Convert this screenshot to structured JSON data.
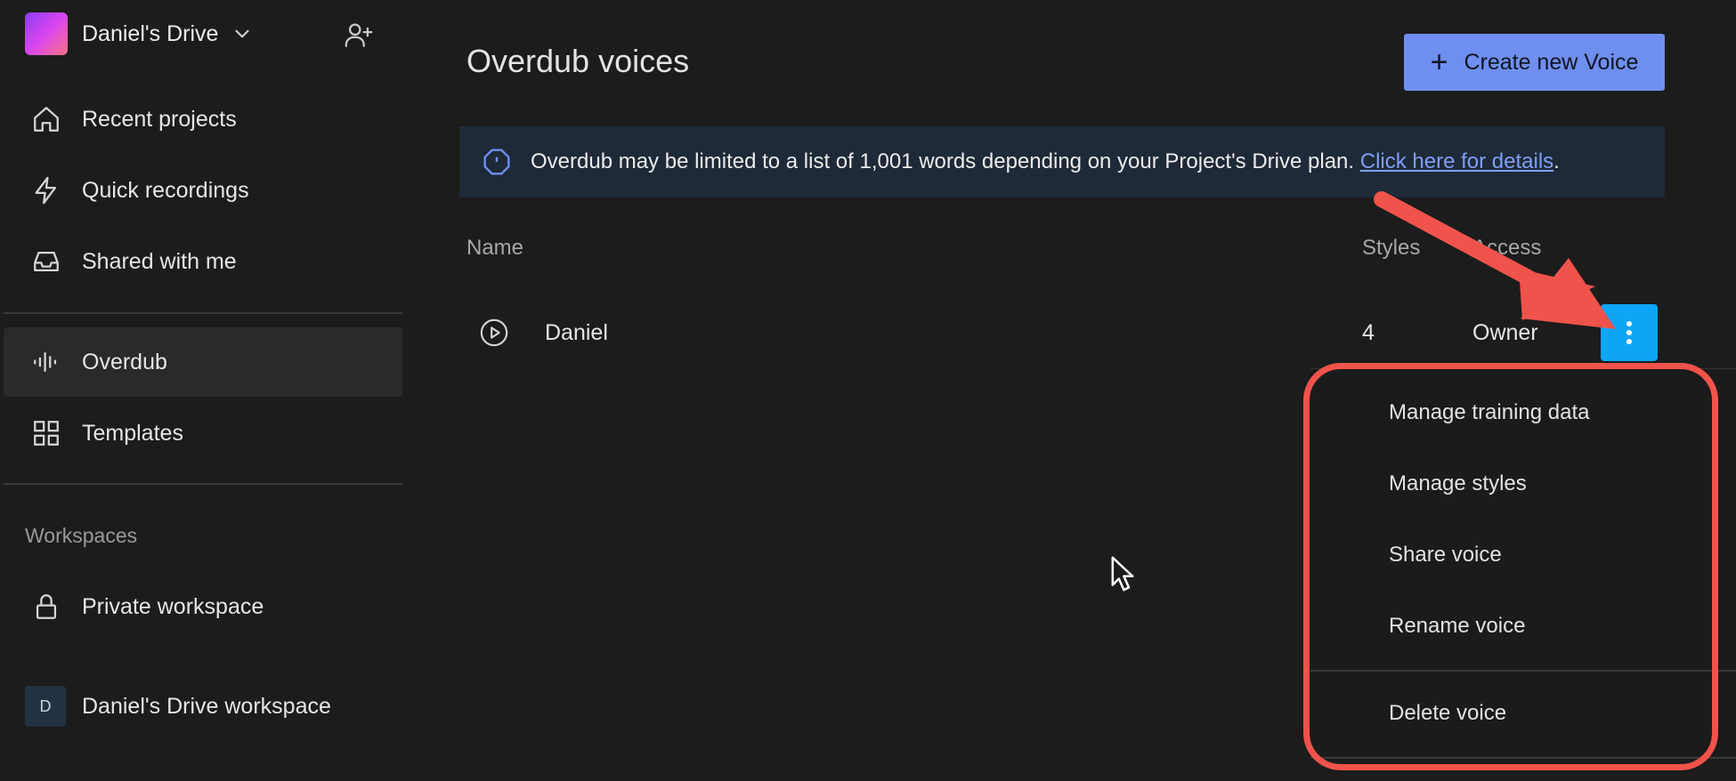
{
  "sidebar": {
    "drive_name": "Daniel's Drive",
    "nav": [
      {
        "label": "Recent projects",
        "icon": "home-icon"
      },
      {
        "label": "Quick recordings",
        "icon": "lightning-icon"
      },
      {
        "label": "Shared with me",
        "icon": "inbox-icon"
      }
    ],
    "tools": [
      {
        "label": "Overdub",
        "icon": "waveform-icon",
        "active": true
      },
      {
        "label": "Templates",
        "icon": "grid-icon"
      }
    ],
    "workspaces_label": "Workspaces",
    "workspaces": [
      {
        "label": "Private workspace",
        "icon": "lock-icon"
      },
      {
        "label": "Daniel's Drive workspace",
        "avatar": "D"
      }
    ]
  },
  "main": {
    "title": "Overdub voices",
    "create_button": "Create new Voice",
    "banner": {
      "text": "Overdub may be limited to a list of 1,001 words depending on your Project's Drive plan. ",
      "link": "Click here for details",
      "suffix": "."
    },
    "columns": {
      "name": "Name",
      "styles": "Styles",
      "access": "Access"
    },
    "rows": [
      {
        "name": "Daniel",
        "styles": "4",
        "access": "Owner"
      }
    ]
  },
  "menu": {
    "items": [
      "Manage training data",
      "Manage styles",
      "Share voice",
      "Rename voice"
    ],
    "danger_item": "Delete voice"
  },
  "colors": {
    "accent": "#6f8ff0",
    "more_button": "#0ea5f7",
    "annotation": "#f0534b",
    "background": "#1c1c1c"
  }
}
